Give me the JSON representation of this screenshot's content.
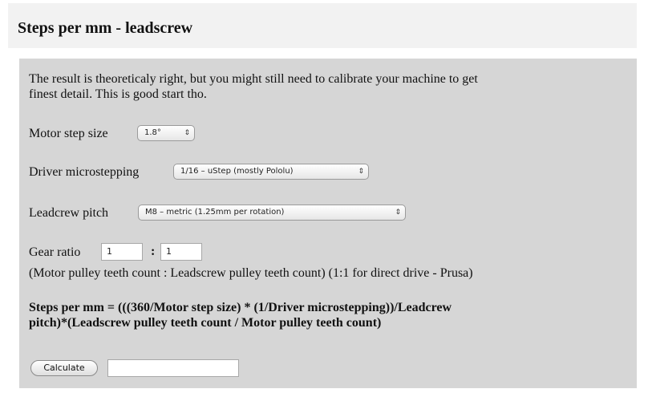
{
  "title": "Steps per mm - leadscrew",
  "intro": [
    "The result is theoreticaly right, but you might still need to calibrate your machine to get",
    "finest detail. This is good start tho."
  ],
  "motor_step": {
    "label": "Motor step size",
    "value": "1.8°"
  },
  "microstepping": {
    "label": "Driver microstepping",
    "value": "1/16 – uStep (mostly Pololu)"
  },
  "pitch": {
    "label": "Leadcrew pitch",
    "value": "M8 – metric (1.25mm per rotation)"
  },
  "gear_ratio": {
    "label": "Gear ratio",
    "motor_teeth": "1",
    "separator": ":",
    "leadscrew_teeth": "1",
    "hint": "(Motor pulley teeth count : Leadscrew pulley teeth count) (1:1 for direct drive - Prusa)"
  },
  "formula": [
    "Steps per mm = (((360/Motor step size) * (1/Driver microstepping))/Leadcrew",
    "pitch)*(Leadscrew pulley teeth count / Motor pulley teeth count)"
  ],
  "calculate_label": "Calculate",
  "result_value": ""
}
